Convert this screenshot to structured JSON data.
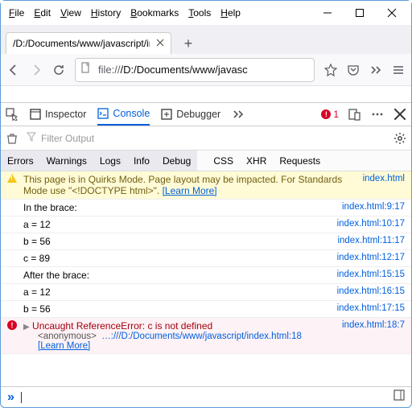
{
  "menu": {
    "file": "File",
    "edit": "Edit",
    "view": "View",
    "history": "History",
    "bookmarks": "Bookmarks",
    "tools": "Tools",
    "help": "Help"
  },
  "tab": {
    "title": "/D:/Documents/www/javascript/ind"
  },
  "url": {
    "scheme": "file://",
    "path": "/D:/Documents/www/javasc"
  },
  "devtools": {
    "inspector": "Inspector",
    "console": "Console",
    "debugger": "Debugger",
    "err_count": "1"
  },
  "filter": {
    "placeholder": "Filter Output"
  },
  "cats": {
    "errors": "Errors",
    "warnings": "Warnings",
    "logs": "Logs",
    "info": "Info",
    "debug": "Debug",
    "css": "CSS",
    "xhr": "XHR",
    "requests": "Requests"
  },
  "rows": {
    "warn_msg": "This page is in Quirks Mode. Page layout may be impacted. For Standards Mode use \"<!DOCTYPE html>\". ",
    "warn_learn": "[Learn More]",
    "warn_loc": "index.html",
    "r0": {
      "msg": "In the brace:",
      "loc": "index.html:9:17"
    },
    "r1": {
      "msg": "a = 12",
      "loc": "index.html:10:17"
    },
    "r2": {
      "msg": "b = 56",
      "loc": "index.html:11:17"
    },
    "r3": {
      "msg": "c = 89",
      "loc": "index.html:12:17"
    },
    "r4": {
      "msg": "After the brace:",
      "loc": "index.html:15:15"
    },
    "r5": {
      "msg": "a = 12",
      "loc": "index.html:16:15"
    },
    "r6": {
      "msg": "b = 56",
      "loc": "index.html:17:15"
    },
    "err_msg": "Uncaught ReferenceError: c is not defined",
    "err_loc": "index.html:18:7",
    "err_anon_label": "<anonymous>",
    "err_anon_path": "…:///D:/Documents/www/javascript/index.html:18",
    "err_learn": "[Learn More]"
  }
}
